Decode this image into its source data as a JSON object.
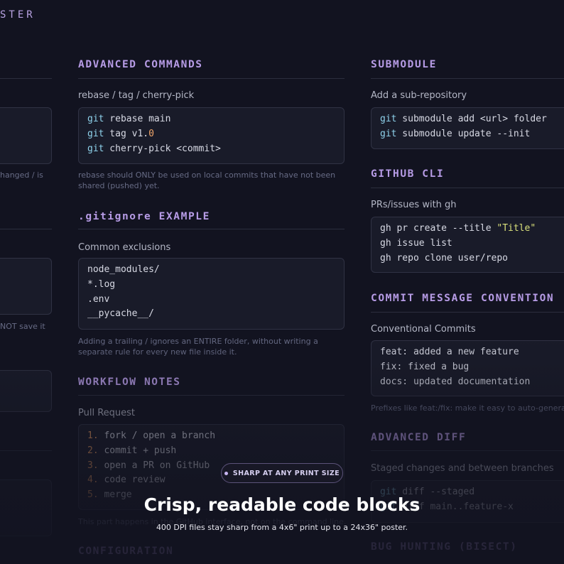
{
  "poster": {
    "title_fragment": "STER"
  },
  "left_column": {
    "note1": "hanged / is",
    "note2": "NOT save it"
  },
  "advanced_commands": {
    "heading": "ADVANCED COMMANDS",
    "subtitle": "rebase / tag / cherry-pick",
    "lines": [
      {
        "cmd": "git",
        "rest": " rebase main",
        "num": ""
      },
      {
        "cmd": "git",
        "rest": " tag v1.",
        "num": "0"
      },
      {
        "cmd": "git",
        "rest": " cherry-pick <commit>",
        "num": ""
      }
    ],
    "note": "rebase should ONLY be used on local commits that have not been shared (pushed) yet."
  },
  "gitignore": {
    "heading": ".gitignore EXAMPLE",
    "subtitle": "Common exclusions",
    "lines": [
      "node_modules/",
      "*.log",
      ".env",
      "__pycache__/"
    ],
    "note": "Adding a trailing / ignores an ENTIRE folder, without writing a separate rule for every new file inside it."
  },
  "workflow": {
    "heading": "WORKFLOW NOTES",
    "subtitle": "Pull Request",
    "lines": [
      {
        "n": "1.",
        "text": " fork / open a branch"
      },
      {
        "n": "2.",
        "text": " commit + push"
      },
      {
        "n": "3.",
        "text": " open a PR on GitHub"
      },
      {
        "n": "4.",
        "text": " code review"
      },
      {
        "n": "5.",
        "text": " merge"
      }
    ],
    "note": "This part happens in the GitHub interface, not on the command line."
  },
  "configuration": {
    "heading": "CONFIGURATION"
  },
  "submodule": {
    "heading": "SUBMODULE",
    "subtitle": "Add a sub-repository",
    "lines": [
      {
        "cmd": "git",
        "rest": " submodule add <url> folder"
      },
      {
        "cmd": "git",
        "rest": " submodule update --init"
      }
    ]
  },
  "github_cli": {
    "heading": "GITHUB CLI",
    "subtitle": "PRs/issues with gh",
    "line1_pre": "gh pr create --title ",
    "line1_str": "\"Title\"",
    "line2": "gh issue list",
    "line3": "gh repo clone user/repo"
  },
  "commit_convention": {
    "heading": "COMMIT MESSAGE CONVENTION",
    "subtitle": "Conventional Commits",
    "lines": [
      "feat: added a new feature",
      "fix: fixed a bug",
      "docs: updated documentation"
    ],
    "note": "Prefixes like feat:/fix: make it easy to auto-generate a"
  },
  "advanced_diff": {
    "heading": "ADVANCED DIFF",
    "subtitle": "Staged changes and between branches",
    "lines": [
      {
        "cmd": "git",
        "rest": " diff --staged"
      },
      {
        "cmd": "git",
        "rest": " diff main..feature-x"
      }
    ]
  },
  "bisect": {
    "heading": "BUG HUNTING (BISECT)"
  },
  "badge": {
    "label": "SHARP AT ANY PRINT SIZE"
  },
  "headline": "Crisp, readable code blocks",
  "tagline": "400 DPI files stay sharp from a 4x6\" print up to a 24x36\" poster.",
  "colors": {
    "background": "#121320",
    "heading": "#b79ce6",
    "keyword": "#8fd3ec",
    "number": "#f0a56a",
    "string": "#d9e07b"
  }
}
